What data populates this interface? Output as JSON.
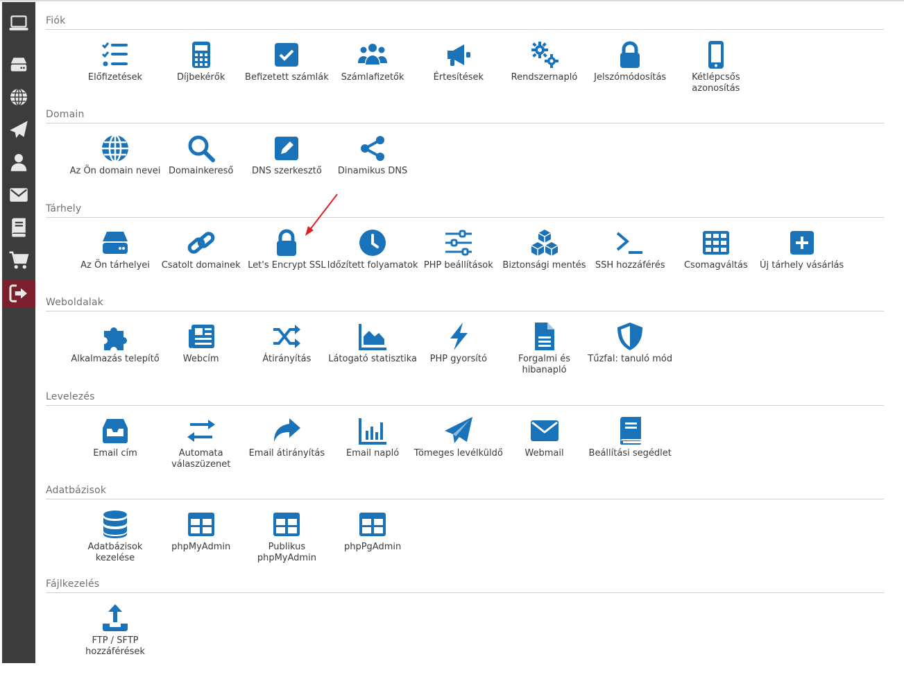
{
  "colors": {
    "icon_blue": "#1a73b8",
    "sidebar_bg": "#3c3c3c",
    "sidebar_icon": "#e8e8e8",
    "logout_bg": "#7a1f2b",
    "annotation_red": "#e02020"
  },
  "sidebar": {
    "items": [
      {
        "icon": "laptop-icon"
      },
      {
        "icon": "server-icon"
      },
      {
        "icon": "globe-icon"
      },
      {
        "icon": "paper-plane-icon"
      },
      {
        "icon": "user-icon"
      },
      {
        "icon": "envelope-icon"
      },
      {
        "icon": "book-icon"
      },
      {
        "icon": "cart-icon"
      },
      {
        "icon": "logout-icon"
      }
    ]
  },
  "sections": [
    {
      "title": "Fiók",
      "tiles": [
        {
          "label": "Előfizetések",
          "icon": "checklist-icon"
        },
        {
          "label": "Díjbekérők",
          "icon": "calculator-icon"
        },
        {
          "label": "Befizetett számlák",
          "icon": "checkbox-icon"
        },
        {
          "label": "Számlafizetők",
          "icon": "users-icon"
        },
        {
          "label": "Értesítések",
          "icon": "megaphone-icon"
        },
        {
          "label": "Rendszernapló",
          "icon": "gears-icon"
        },
        {
          "label": "Jelszómódosítás",
          "icon": "lock-icon"
        },
        {
          "label": "Kétlépcsős azonosítás",
          "icon": "mobile-icon"
        }
      ]
    },
    {
      "title": "Domain",
      "tiles": [
        {
          "label": "Az Ön domain nevei",
          "icon": "globe-icon"
        },
        {
          "label": "Domainkereső",
          "icon": "search-icon"
        },
        {
          "label": "DNS szerkesztő",
          "icon": "edit-icon"
        },
        {
          "label": "Dinamikus DNS",
          "icon": "share-icon"
        }
      ]
    },
    {
      "title": "Tárhely",
      "tiles": [
        {
          "label": "Az Ön tárhelyei",
          "icon": "hdd-icon"
        },
        {
          "label": "Csatolt domainek",
          "icon": "link-icon"
        },
        {
          "label": "Let's Encrypt SSL",
          "icon": "lock-icon"
        },
        {
          "label": "Időzített folyamatok",
          "icon": "clock-icon"
        },
        {
          "label": "PHP beállítások",
          "icon": "sliders-icon"
        },
        {
          "label": "Biztonsági mentés",
          "icon": "cubes-icon"
        },
        {
          "label": "SSH hozzáférés",
          "icon": "terminal-icon"
        },
        {
          "label": "Csomagváltás",
          "icon": "grid-icon"
        },
        {
          "label": "Új tárhely vásárlás",
          "icon": "plus-square-icon"
        }
      ]
    },
    {
      "title": "Weboldalak",
      "tiles": [
        {
          "label": "Alkalmazás telepítő",
          "icon": "puzzle-icon"
        },
        {
          "label": "Webcím",
          "icon": "newspaper-icon"
        },
        {
          "label": "Átirányítás",
          "icon": "shuffle-icon"
        },
        {
          "label": "Látogató statisztika",
          "icon": "area-chart-icon"
        },
        {
          "label": "PHP gyorsító",
          "icon": "bolt-icon"
        },
        {
          "label": "Forgalmi és hibanapló",
          "icon": "file-icon"
        },
        {
          "label": "Tűzfal: tanuló mód",
          "icon": "shield-icon"
        }
      ]
    },
    {
      "title": "Levelezés",
      "tiles": [
        {
          "label": "Email cím",
          "icon": "inbox-icon"
        },
        {
          "label": "Automata válaszüzenet",
          "icon": "exchange-icon"
        },
        {
          "label": "Email átirányítás",
          "icon": "forward-icon"
        },
        {
          "label": "Email napló",
          "icon": "bar-chart-icon"
        },
        {
          "label": "Tömeges levélküldő",
          "icon": "paper-plane-icon"
        },
        {
          "label": "Webmail",
          "icon": "envelope-icon"
        },
        {
          "label": "Beállítási segédlet",
          "icon": "book-icon"
        }
      ]
    },
    {
      "title": "Adatbázisok",
      "tiles": [
        {
          "label": "Adatbázisok kezelése",
          "icon": "database-icon"
        },
        {
          "label": "phpMyAdmin",
          "icon": "table-icon"
        },
        {
          "label": "Publikus phpMyAdmin",
          "icon": "table-icon"
        },
        {
          "label": "phpPgAdmin",
          "icon": "table-icon"
        }
      ]
    },
    {
      "title": "Fájlkezelés",
      "tiles": [
        {
          "label": "FTP / SFTP hozzáférések",
          "icon": "upload-icon"
        }
      ]
    }
  ]
}
